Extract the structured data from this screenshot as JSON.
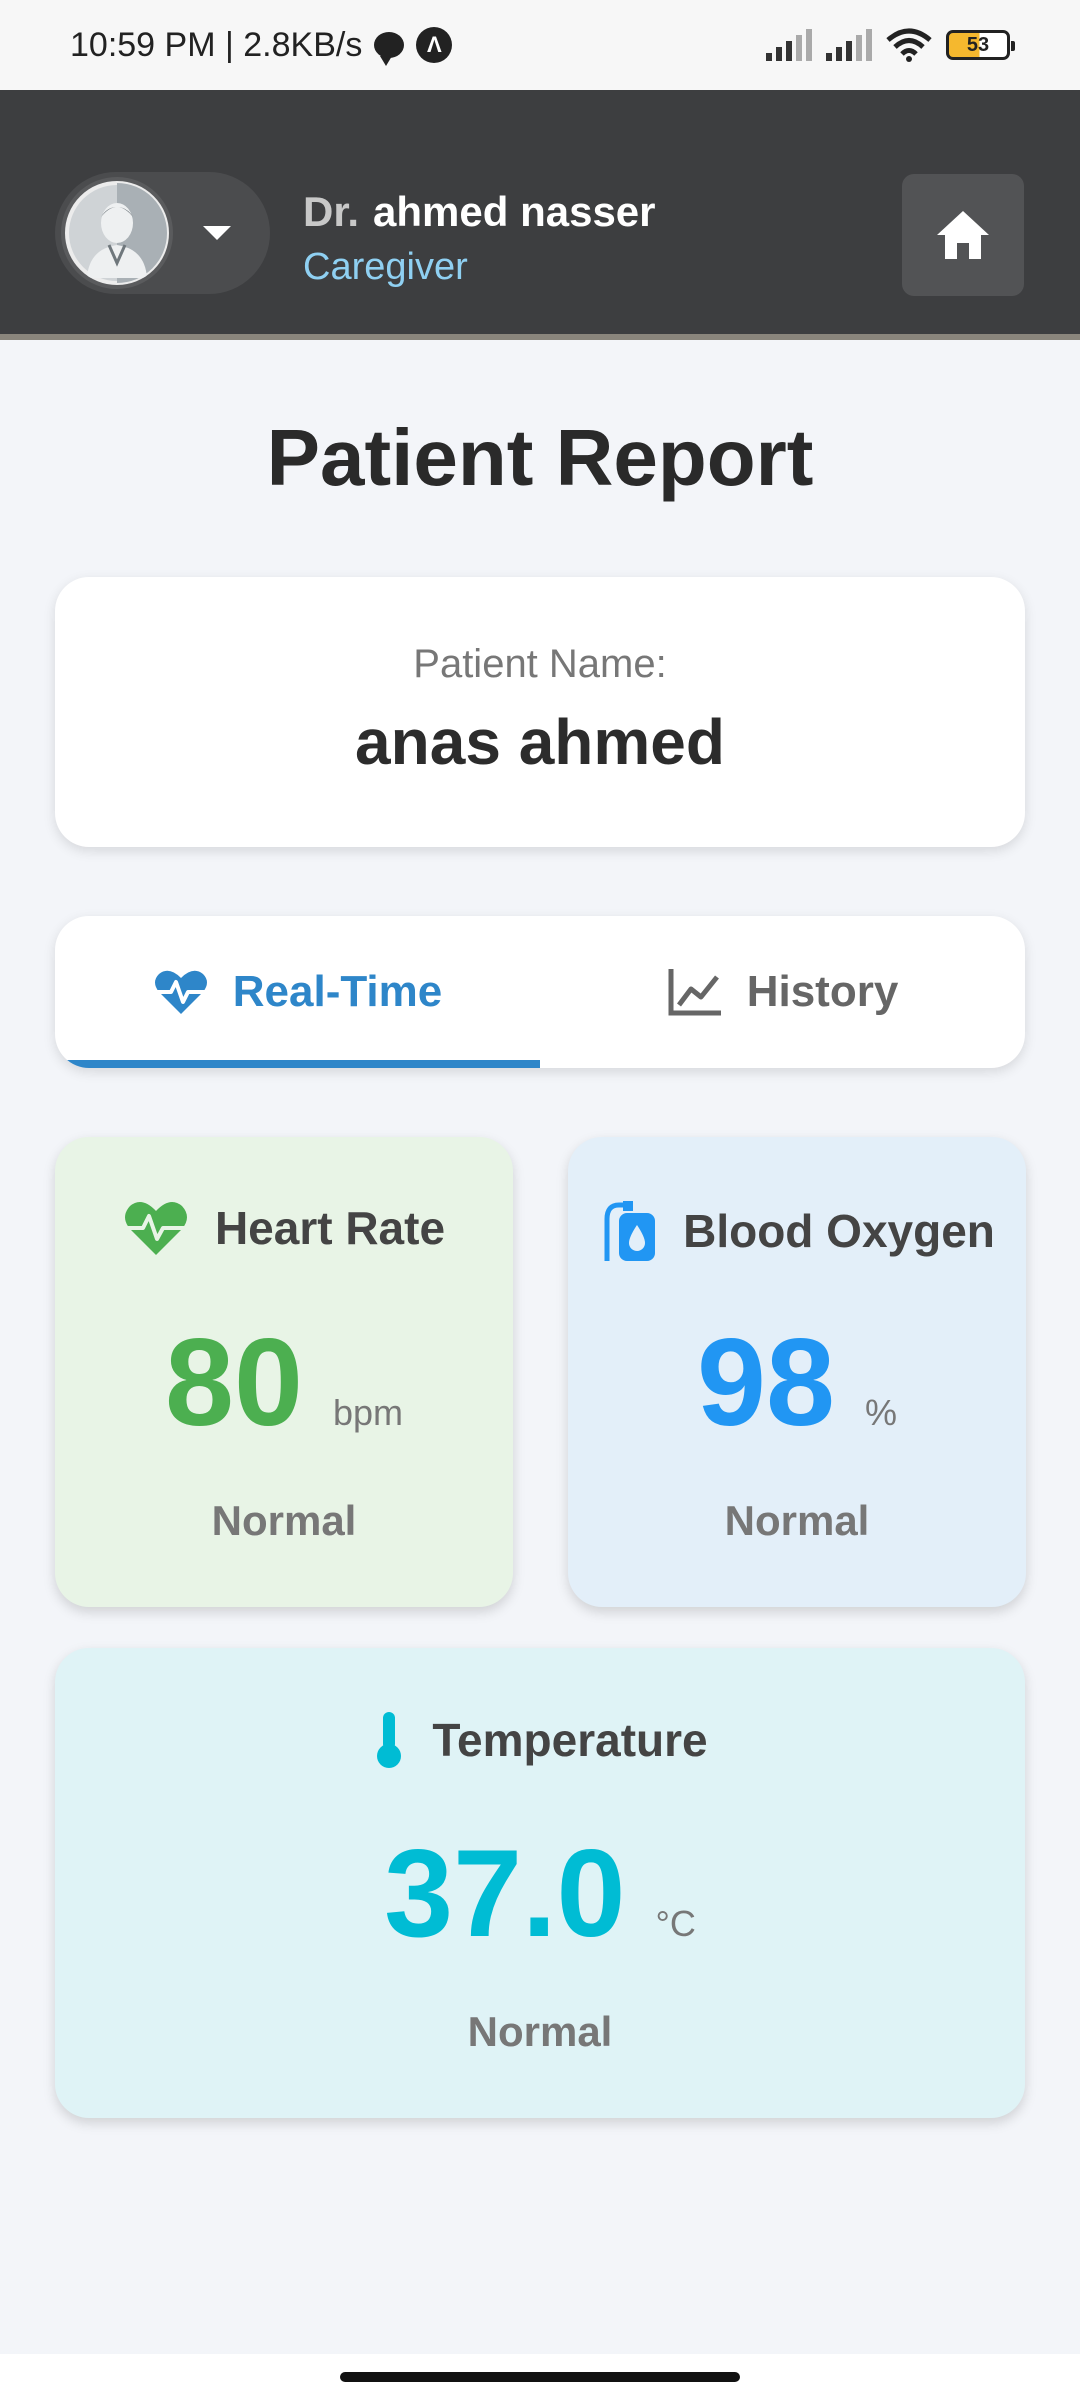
{
  "status_bar": {
    "time_net": "10:59 PM | 2.8KB/s",
    "a_icon_letter": "Λ",
    "battery": "53"
  },
  "header": {
    "prefix": "Dr.",
    "name": "ahmed nasser",
    "role": "Caregiver"
  },
  "page": {
    "title": "Patient Report"
  },
  "patient": {
    "label": "Patient Name:",
    "name": "anas ahmed"
  },
  "tabs": [
    {
      "label": "Real-Time",
      "active": true
    },
    {
      "label": "History",
      "active": false
    }
  ],
  "metrics": {
    "heart_rate": {
      "title": "Heart Rate",
      "value": "80",
      "unit": "bpm",
      "status": "Normal",
      "color": "#4caf50"
    },
    "blood_oxygen": {
      "title": "Blood Oxygen",
      "value": "98",
      "unit": "%",
      "status": "Normal",
      "color": "#2196f3"
    },
    "temperature": {
      "title": "Temperature",
      "value": "37.0",
      "unit": "°C",
      "status": "Normal",
      "color": "#00bcd4"
    }
  },
  "colors": {
    "accent": "#2e86c9",
    "header_bg": "#3d3e40",
    "role": "#8fd0f2"
  }
}
